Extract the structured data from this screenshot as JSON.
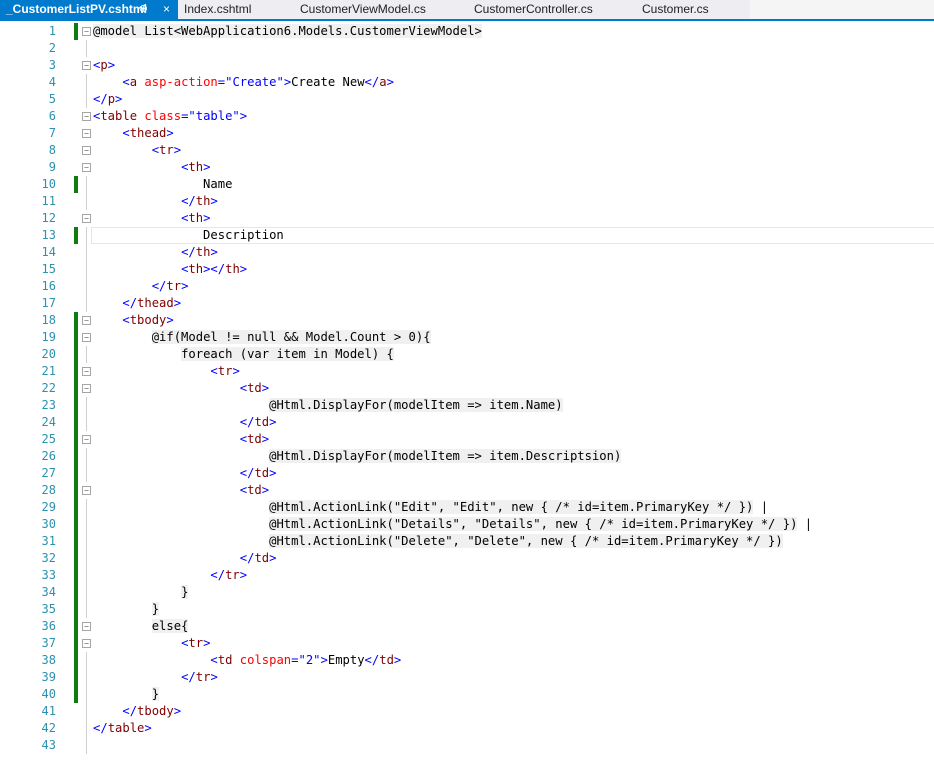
{
  "tabs": [
    {
      "label": "_CustomerListPV.cshtml",
      "active": true,
      "pin": "⊕",
      "close": "×"
    },
    {
      "label": "Index.cshtml",
      "active": false
    },
    {
      "label": "CustomerViewModel.cs",
      "active": false
    },
    {
      "label": "CustomerController.cs",
      "active": false
    },
    {
      "label": "Customer.cs",
      "active": false
    }
  ],
  "colors": {
    "accent": "#007acc",
    "line_number": "#2b91af",
    "change_bar": "#107c10",
    "tag": "#800000",
    "attribute": "#ff0000",
    "string": "#0000ff"
  },
  "lines": [
    {
      "n": "1",
      "fold": "−",
      "chg": true,
      "segs": [
        [
          "@model List<WebApplication6.Models.CustomerViewModel>",
          "hl"
        ]
      ]
    },
    {
      "n": "2",
      "segs": []
    },
    {
      "n": "3",
      "fold": "−",
      "segs": [
        [
          "<",
          "b"
        ],
        [
          "p",
          "t"
        ],
        [
          ">",
          "b"
        ]
      ]
    },
    {
      "n": "4",
      "segs": [
        [
          "    ",
          ""
        ],
        [
          "<",
          "b"
        ],
        [
          "a",
          "t"
        ],
        [
          " ",
          ""
        ],
        [
          "asp-action",
          "a"
        ],
        [
          "=",
          "b"
        ],
        [
          "\"Create\"",
          "s"
        ],
        [
          ">",
          "b"
        ],
        [
          "Create New",
          ""
        ],
        [
          "</",
          "b"
        ],
        [
          "a",
          "t"
        ],
        [
          ">",
          "b"
        ]
      ]
    },
    {
      "n": "5",
      "segs": [
        [
          "</",
          "b"
        ],
        [
          "p",
          "t"
        ],
        [
          ">",
          "b"
        ]
      ]
    },
    {
      "n": "6",
      "fold": "−",
      "segs": [
        [
          "<",
          "b"
        ],
        [
          "table",
          "t"
        ],
        [
          " ",
          ""
        ],
        [
          "class",
          "a"
        ],
        [
          "=",
          "b"
        ],
        [
          "\"table\"",
          "s"
        ],
        [
          ">",
          "b"
        ]
      ]
    },
    {
      "n": "7",
      "fold": "−",
      "segs": [
        [
          "    ",
          ""
        ],
        [
          "<",
          "b"
        ],
        [
          "thead",
          "t"
        ],
        [
          ">",
          "b"
        ]
      ]
    },
    {
      "n": "8",
      "fold": "−",
      "segs": [
        [
          "        ",
          ""
        ],
        [
          "<",
          "b"
        ],
        [
          "tr",
          "t"
        ],
        [
          ">",
          "b"
        ]
      ]
    },
    {
      "n": "9",
      "fold": "−",
      "segs": [
        [
          "            ",
          ""
        ],
        [
          "<",
          "b"
        ],
        [
          "th",
          "t"
        ],
        [
          ">",
          "b"
        ]
      ]
    },
    {
      "n": "10",
      "chg": true,
      "segs": [
        [
          "               Name",
          ""
        ]
      ]
    },
    {
      "n": "11",
      "segs": [
        [
          "            ",
          ""
        ],
        [
          "</",
          "b"
        ],
        [
          "th",
          "t"
        ],
        [
          ">",
          "b"
        ]
      ]
    },
    {
      "n": "12",
      "fold": "−",
      "segs": [
        [
          "            ",
          ""
        ],
        [
          "<",
          "b"
        ],
        [
          "th",
          "t"
        ],
        [
          ">",
          "b"
        ]
      ]
    },
    {
      "n": "13",
      "chg": true,
      "cur": true,
      "segs": [
        [
          "               Description",
          ""
        ]
      ]
    },
    {
      "n": "14",
      "segs": [
        [
          "            ",
          ""
        ],
        [
          "</",
          "b"
        ],
        [
          "th",
          "t"
        ],
        [
          ">",
          "b"
        ]
      ]
    },
    {
      "n": "15",
      "segs": [
        [
          "            ",
          ""
        ],
        [
          "<",
          "b"
        ],
        [
          "th",
          "t"
        ],
        [
          "></",
          "b"
        ],
        [
          "th",
          "t"
        ],
        [
          ">",
          "b"
        ]
      ]
    },
    {
      "n": "16",
      "segs": [
        [
          "        ",
          ""
        ],
        [
          "</",
          "b"
        ],
        [
          "tr",
          "t"
        ],
        [
          ">",
          "b"
        ]
      ]
    },
    {
      "n": "17",
      "segs": [
        [
          "    ",
          ""
        ],
        [
          "</",
          "b"
        ],
        [
          "thead",
          "t"
        ],
        [
          ">",
          "b"
        ]
      ]
    },
    {
      "n": "18",
      "fold": "−",
      "chg": true,
      "segs": [
        [
          "    ",
          ""
        ],
        [
          "<",
          "b"
        ],
        [
          "tbody",
          "t"
        ],
        [
          ">",
          "b"
        ]
      ]
    },
    {
      "n": "19",
      "fold": "−",
      "chg": true,
      "segs": [
        [
          "        ",
          ""
        ],
        [
          "@if(Model != null && Model.Count > 0){",
          "hl"
        ]
      ]
    },
    {
      "n": "20",
      "chg": true,
      "segs": [
        [
          "            ",
          ""
        ],
        [
          "foreach (var item in Model) {",
          "hl"
        ]
      ]
    },
    {
      "n": "21",
      "fold": "−",
      "chg": true,
      "segs": [
        [
          "                ",
          ""
        ],
        [
          "<",
          "b"
        ],
        [
          "tr",
          "t"
        ],
        [
          ">",
          "b"
        ]
      ]
    },
    {
      "n": "22",
      "fold": "−",
      "chg": true,
      "segs": [
        [
          "                    ",
          ""
        ],
        [
          "<",
          "b"
        ],
        [
          "td",
          "t"
        ],
        [
          ">",
          "b"
        ]
      ]
    },
    {
      "n": "23",
      "chg": true,
      "segs": [
        [
          "                        ",
          ""
        ],
        [
          "@Html.DisplayFor(modelItem => item.Name)",
          "hl"
        ]
      ]
    },
    {
      "n": "24",
      "chg": true,
      "segs": [
        [
          "                    ",
          ""
        ],
        [
          "</",
          "b"
        ],
        [
          "td",
          "t"
        ],
        [
          ">",
          "b"
        ]
      ]
    },
    {
      "n": "25",
      "fold": "−",
      "chg": true,
      "segs": [
        [
          "                    ",
          ""
        ],
        [
          "<",
          "b"
        ],
        [
          "td",
          "t"
        ],
        [
          ">",
          "b"
        ]
      ]
    },
    {
      "n": "26",
      "chg": true,
      "segs": [
        [
          "                        ",
          ""
        ],
        [
          "@Html.DisplayFor(modelItem => item.Descriptsion)",
          "hl"
        ]
      ]
    },
    {
      "n": "27",
      "chg": true,
      "segs": [
        [
          "                    ",
          ""
        ],
        [
          "</",
          "b"
        ],
        [
          "td",
          "t"
        ],
        [
          ">",
          "b"
        ]
      ]
    },
    {
      "n": "28",
      "fold": "−",
      "chg": true,
      "segs": [
        [
          "                    ",
          ""
        ],
        [
          "<",
          "b"
        ],
        [
          "td",
          "t"
        ],
        [
          ">",
          "b"
        ]
      ]
    },
    {
      "n": "29",
      "chg": true,
      "segs": [
        [
          "                        ",
          ""
        ],
        [
          "@Html.ActionLink(\"Edit\", \"Edit\", new { /* id=item.PrimaryKey */ })",
          "hl"
        ],
        [
          " |",
          ""
        ]
      ]
    },
    {
      "n": "30",
      "chg": true,
      "segs": [
        [
          "                        ",
          ""
        ],
        [
          "@Html.ActionLink(\"Details\", \"Details\", new { /* id=item.PrimaryKey */ })",
          "hl"
        ],
        [
          " |",
          ""
        ]
      ]
    },
    {
      "n": "31",
      "chg": true,
      "segs": [
        [
          "                        ",
          ""
        ],
        [
          "@Html.ActionLink(\"Delete\", \"Delete\", new { /* id=item.PrimaryKey */ })",
          "hl"
        ]
      ]
    },
    {
      "n": "32",
      "chg": true,
      "segs": [
        [
          "                    ",
          ""
        ],
        [
          "</",
          "b"
        ],
        [
          "td",
          "t"
        ],
        [
          ">",
          "b"
        ]
      ]
    },
    {
      "n": "33",
      "chg": true,
      "segs": [
        [
          "                ",
          ""
        ],
        [
          "</",
          "b"
        ],
        [
          "tr",
          "t"
        ],
        [
          ">",
          "b"
        ]
      ]
    },
    {
      "n": "34",
      "chg": true,
      "segs": [
        [
          "            ",
          ""
        ],
        [
          "}",
          "hl"
        ]
      ]
    },
    {
      "n": "35",
      "chg": true,
      "segs": [
        [
          "        ",
          ""
        ],
        [
          "}",
          "hl"
        ]
      ]
    },
    {
      "n": "36",
      "fold": "−",
      "chg": true,
      "segs": [
        [
          "        ",
          ""
        ],
        [
          "else{",
          "hl"
        ]
      ]
    },
    {
      "n": "37",
      "fold": "−",
      "chg": true,
      "segs": [
        [
          "            ",
          ""
        ],
        [
          "<",
          "b"
        ],
        [
          "tr",
          "t"
        ],
        [
          ">",
          "b"
        ]
      ]
    },
    {
      "n": "38",
      "chg": true,
      "segs": [
        [
          "                ",
          ""
        ],
        [
          "<",
          "b"
        ],
        [
          "td",
          "t"
        ],
        [
          " ",
          ""
        ],
        [
          "colspan",
          "a"
        ],
        [
          "=",
          "b"
        ],
        [
          "\"2\"",
          "s"
        ],
        [
          ">",
          "b"
        ],
        [
          "Empty",
          ""
        ],
        [
          "</",
          "b"
        ],
        [
          "td",
          "t"
        ],
        [
          ">",
          "b"
        ]
      ]
    },
    {
      "n": "39",
      "chg": true,
      "segs": [
        [
          "            ",
          ""
        ],
        [
          "</",
          "b"
        ],
        [
          "tr",
          "t"
        ],
        [
          ">",
          "b"
        ]
      ]
    },
    {
      "n": "40",
      "chg": true,
      "segs": [
        [
          "        ",
          ""
        ],
        [
          "}",
          "hl"
        ]
      ]
    },
    {
      "n": "41",
      "segs": [
        [
          "    ",
          ""
        ],
        [
          "</",
          "b"
        ],
        [
          "tbody",
          "t"
        ],
        [
          ">",
          "b"
        ]
      ]
    },
    {
      "n": "42",
      "segs": [
        [
          "</",
          "b"
        ],
        [
          "table",
          "t"
        ],
        [
          ">",
          "b"
        ]
      ]
    },
    {
      "n": "43",
      "segs": []
    }
  ]
}
